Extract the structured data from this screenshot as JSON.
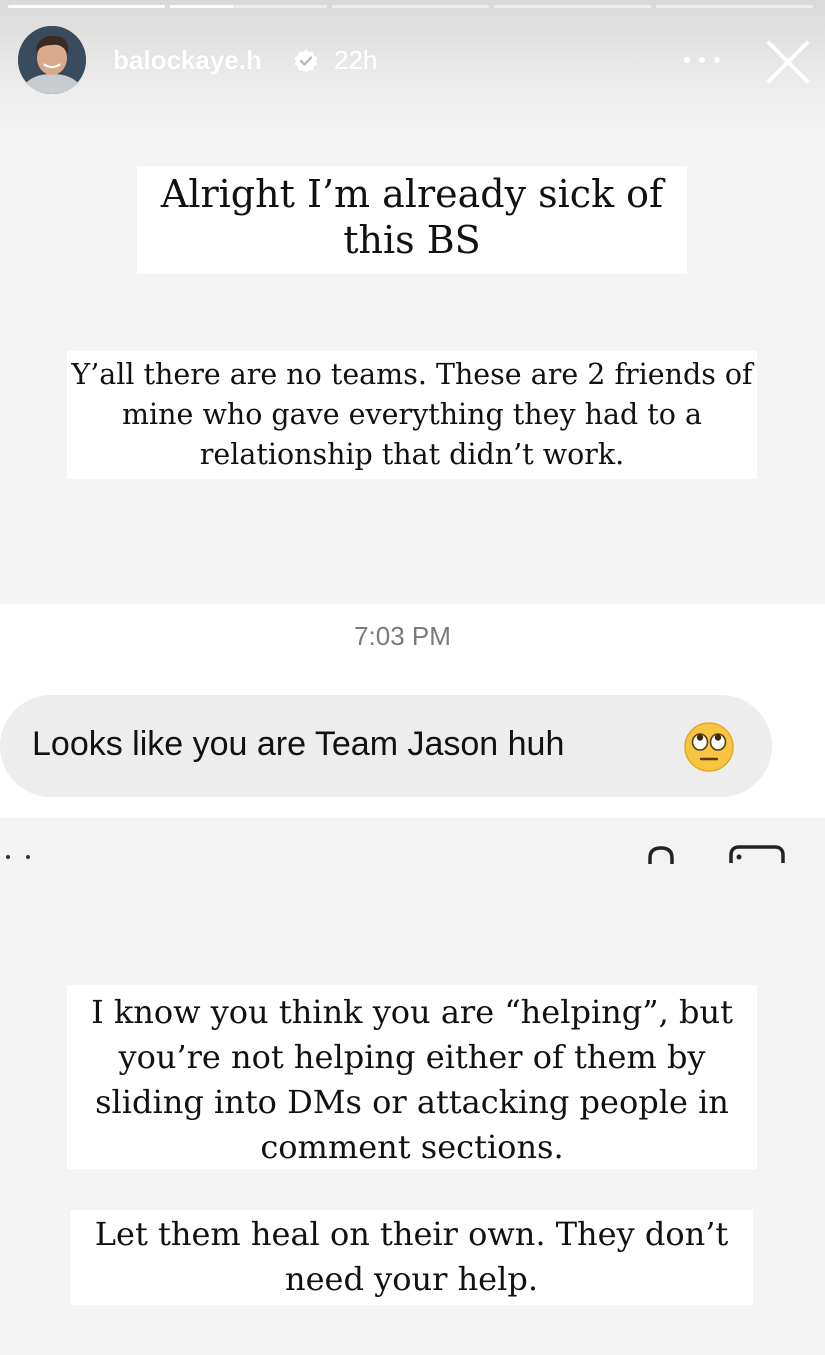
{
  "story": {
    "progress_segments": [
      1,
      0.4,
      0,
      0,
      0
    ]
  },
  "header": {
    "username": "balockaye.h",
    "time_ago": "22h",
    "avatar_icon": "person-avatar",
    "verified_icon": "verified-badge-icon",
    "more_icon": "more-horizontal-icon",
    "close_icon": "close-icon"
  },
  "captions": {
    "title": "Alright I’m already sick of this BS",
    "paragraph1": "Y’all there are no teams. These are 2 friends of mine who gave everything they had to a relationship that didn’t work.",
    "paragraph2": "I know you think you are “helping”, but you’re not helping either of them by sliding into DMs or attacking people in comment sections.",
    "paragraph3": "Let them heal on their own. They don’t need your help."
  },
  "dm": {
    "timestamp": "7:03 PM",
    "message": "Looks like you are Team Jason huh",
    "emoji_icon": "eye-roll-emoji"
  },
  "colors": {
    "background": "#f4f4f4",
    "caption_bg": "#ffffff",
    "bubble_bg": "#ededed",
    "text": "#111111",
    "timestamp": "#7a7a7a"
  }
}
